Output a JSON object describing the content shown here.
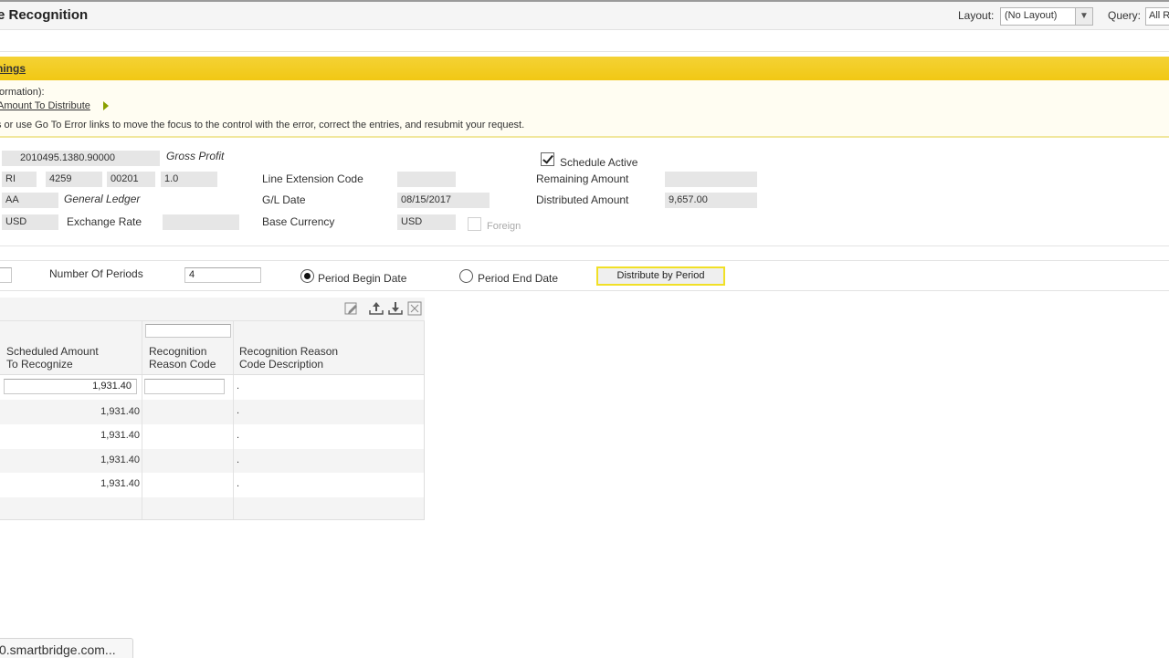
{
  "header": {
    "title": "e Recognition",
    "layout_label": "Layout:",
    "layout_value": "(No Layout)",
    "query_label": "Query:",
    "query_value": "All R"
  },
  "warning": {
    "title": "nings",
    "line1": "formation):",
    "link": "Amount To Distribute",
    "line3": "s or use Go To Error links to move the focus to the control with the error, correct the entries, and resubmit your request."
  },
  "form": {
    "account_value": "2010495.1380.90000",
    "account_desc": "Gross Profit",
    "doc_type": "RI",
    "doc_number": "4259",
    "doc_company": "00201",
    "line_number": "1.0",
    "ledger_type": "AA",
    "ledger_desc": "General Ledger",
    "currency": "USD",
    "exchange_rate_label": "Exchange Rate",
    "exchange_rate_value": "",
    "line_ext_label": "Line Extension Code",
    "line_ext_value": "",
    "gl_date_label": "G/L Date",
    "gl_date_value": "08/15/2017",
    "base_currency_label": "Base Currency",
    "base_currency_value": "USD",
    "foreign_label": "Foreign",
    "schedule_active_label": "Schedule Active",
    "remaining_label": "Remaining Amount",
    "remaining_value": "",
    "distributed_label": "Distributed Amount",
    "distributed_value": "9,657.00"
  },
  "distribution": {
    "periods_label": "Number Of Periods",
    "periods_value": "4",
    "begin_label": "Period Begin Date",
    "end_label": "Period End Date",
    "button": "Distribute by Period"
  },
  "grid": {
    "toolbar_icons": [
      "edit-icon",
      "export-icon",
      "download-icon",
      "expand-icon"
    ],
    "columns": [
      {
        "label_1": "Scheduled Amount",
        "label_2": "To Recognize"
      },
      {
        "label_1": "Recognition",
        "label_2": "Reason Code"
      },
      {
        "label_1": "Recognition Reason",
        "label_2": "Code Description"
      }
    ],
    "rows": [
      {
        "amount": "1,931.40",
        "reason_code": "",
        "description": "."
      },
      {
        "amount": "1,931.40",
        "reason_code": "",
        "description": "."
      },
      {
        "amount": "1,931.40",
        "reason_code": "",
        "description": "."
      },
      {
        "amount": "1,931.40",
        "reason_code": "",
        "description": "."
      },
      {
        "amount": "1,931.40",
        "reason_code": "",
        "description": "."
      }
    ]
  },
  "statusbar": {
    "url": "0.smartbridge.com..."
  }
}
